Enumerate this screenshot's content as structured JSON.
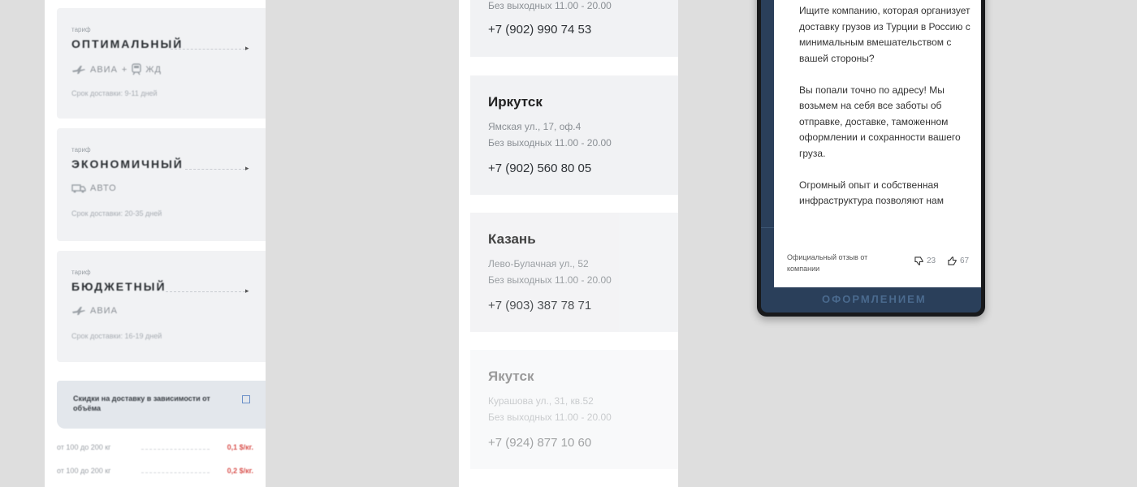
{
  "tariffs": [
    {
      "tag": "тариф",
      "name": "ОПТИМАЛЬНЫЙ",
      "modes": [
        "АВИА",
        "ЖД"
      ],
      "term": "Срок доставки: 9-11 дней"
    },
    {
      "tag": "тариф",
      "name": "ЭКОНОМИЧНЫЙ",
      "modes": [
        "АВТО"
      ],
      "term": "Срок доставки: 20-35 дней"
    },
    {
      "tag": "тариф",
      "name": "БЮДЖЕТНЫЙ",
      "modes": [
        "АВИА"
      ],
      "term": "Срок доставки: 16-19 дней"
    }
  ],
  "discount": {
    "text": "Скидки на доставку в зависимости от объёма"
  },
  "rates": [
    {
      "label": "от 100 до 200 кг",
      "price": "0,1 $/кг."
    },
    {
      "label": "от 100 до 200 кг",
      "price": "0,2 $/кг."
    }
  ],
  "offices": [
    {
      "hours": "Без выходных 11.00 - 20.00",
      "phone": "+7 (902) 990 74 53"
    },
    {
      "city": "Иркутск",
      "address": "Ямская ул., 17, оф.4",
      "hours": "Без выходных 11.00 - 20.00",
      "phone": "+7 (902) 560 80 05"
    },
    {
      "city": "Казань",
      "address": "Лево-Булачная ул., 52",
      "hours": "Без выходных 11.00 - 20.00",
      "phone": "+7 (903) 387 78 71"
    },
    {
      "city": "Якутск",
      "address": "Курашова ул., 31, кв.52",
      "hours": "Без выходных 11.00 - 20.00",
      "phone": "+7 (924) 877 10 60"
    }
  ],
  "review": {
    "paragraphs": [
      "Ищите компанию, которая организует доставку грузов из Турции в Россию с минимальным вмешательством с вашей стороны?",
      "Вы попали точно по адресу! Мы возьмем на себя все заботы об отправке, доставке, таможенном оформлении и сохранности вашего груза.",
      "Огромный опыт и собственная инфраструктура позволяют нам"
    ],
    "footer_label": "Официальный отзыв от компании",
    "dislikes": "23",
    "likes": "67"
  },
  "phone_bottom_text": "ОФОРМЛЕНИЕМ"
}
